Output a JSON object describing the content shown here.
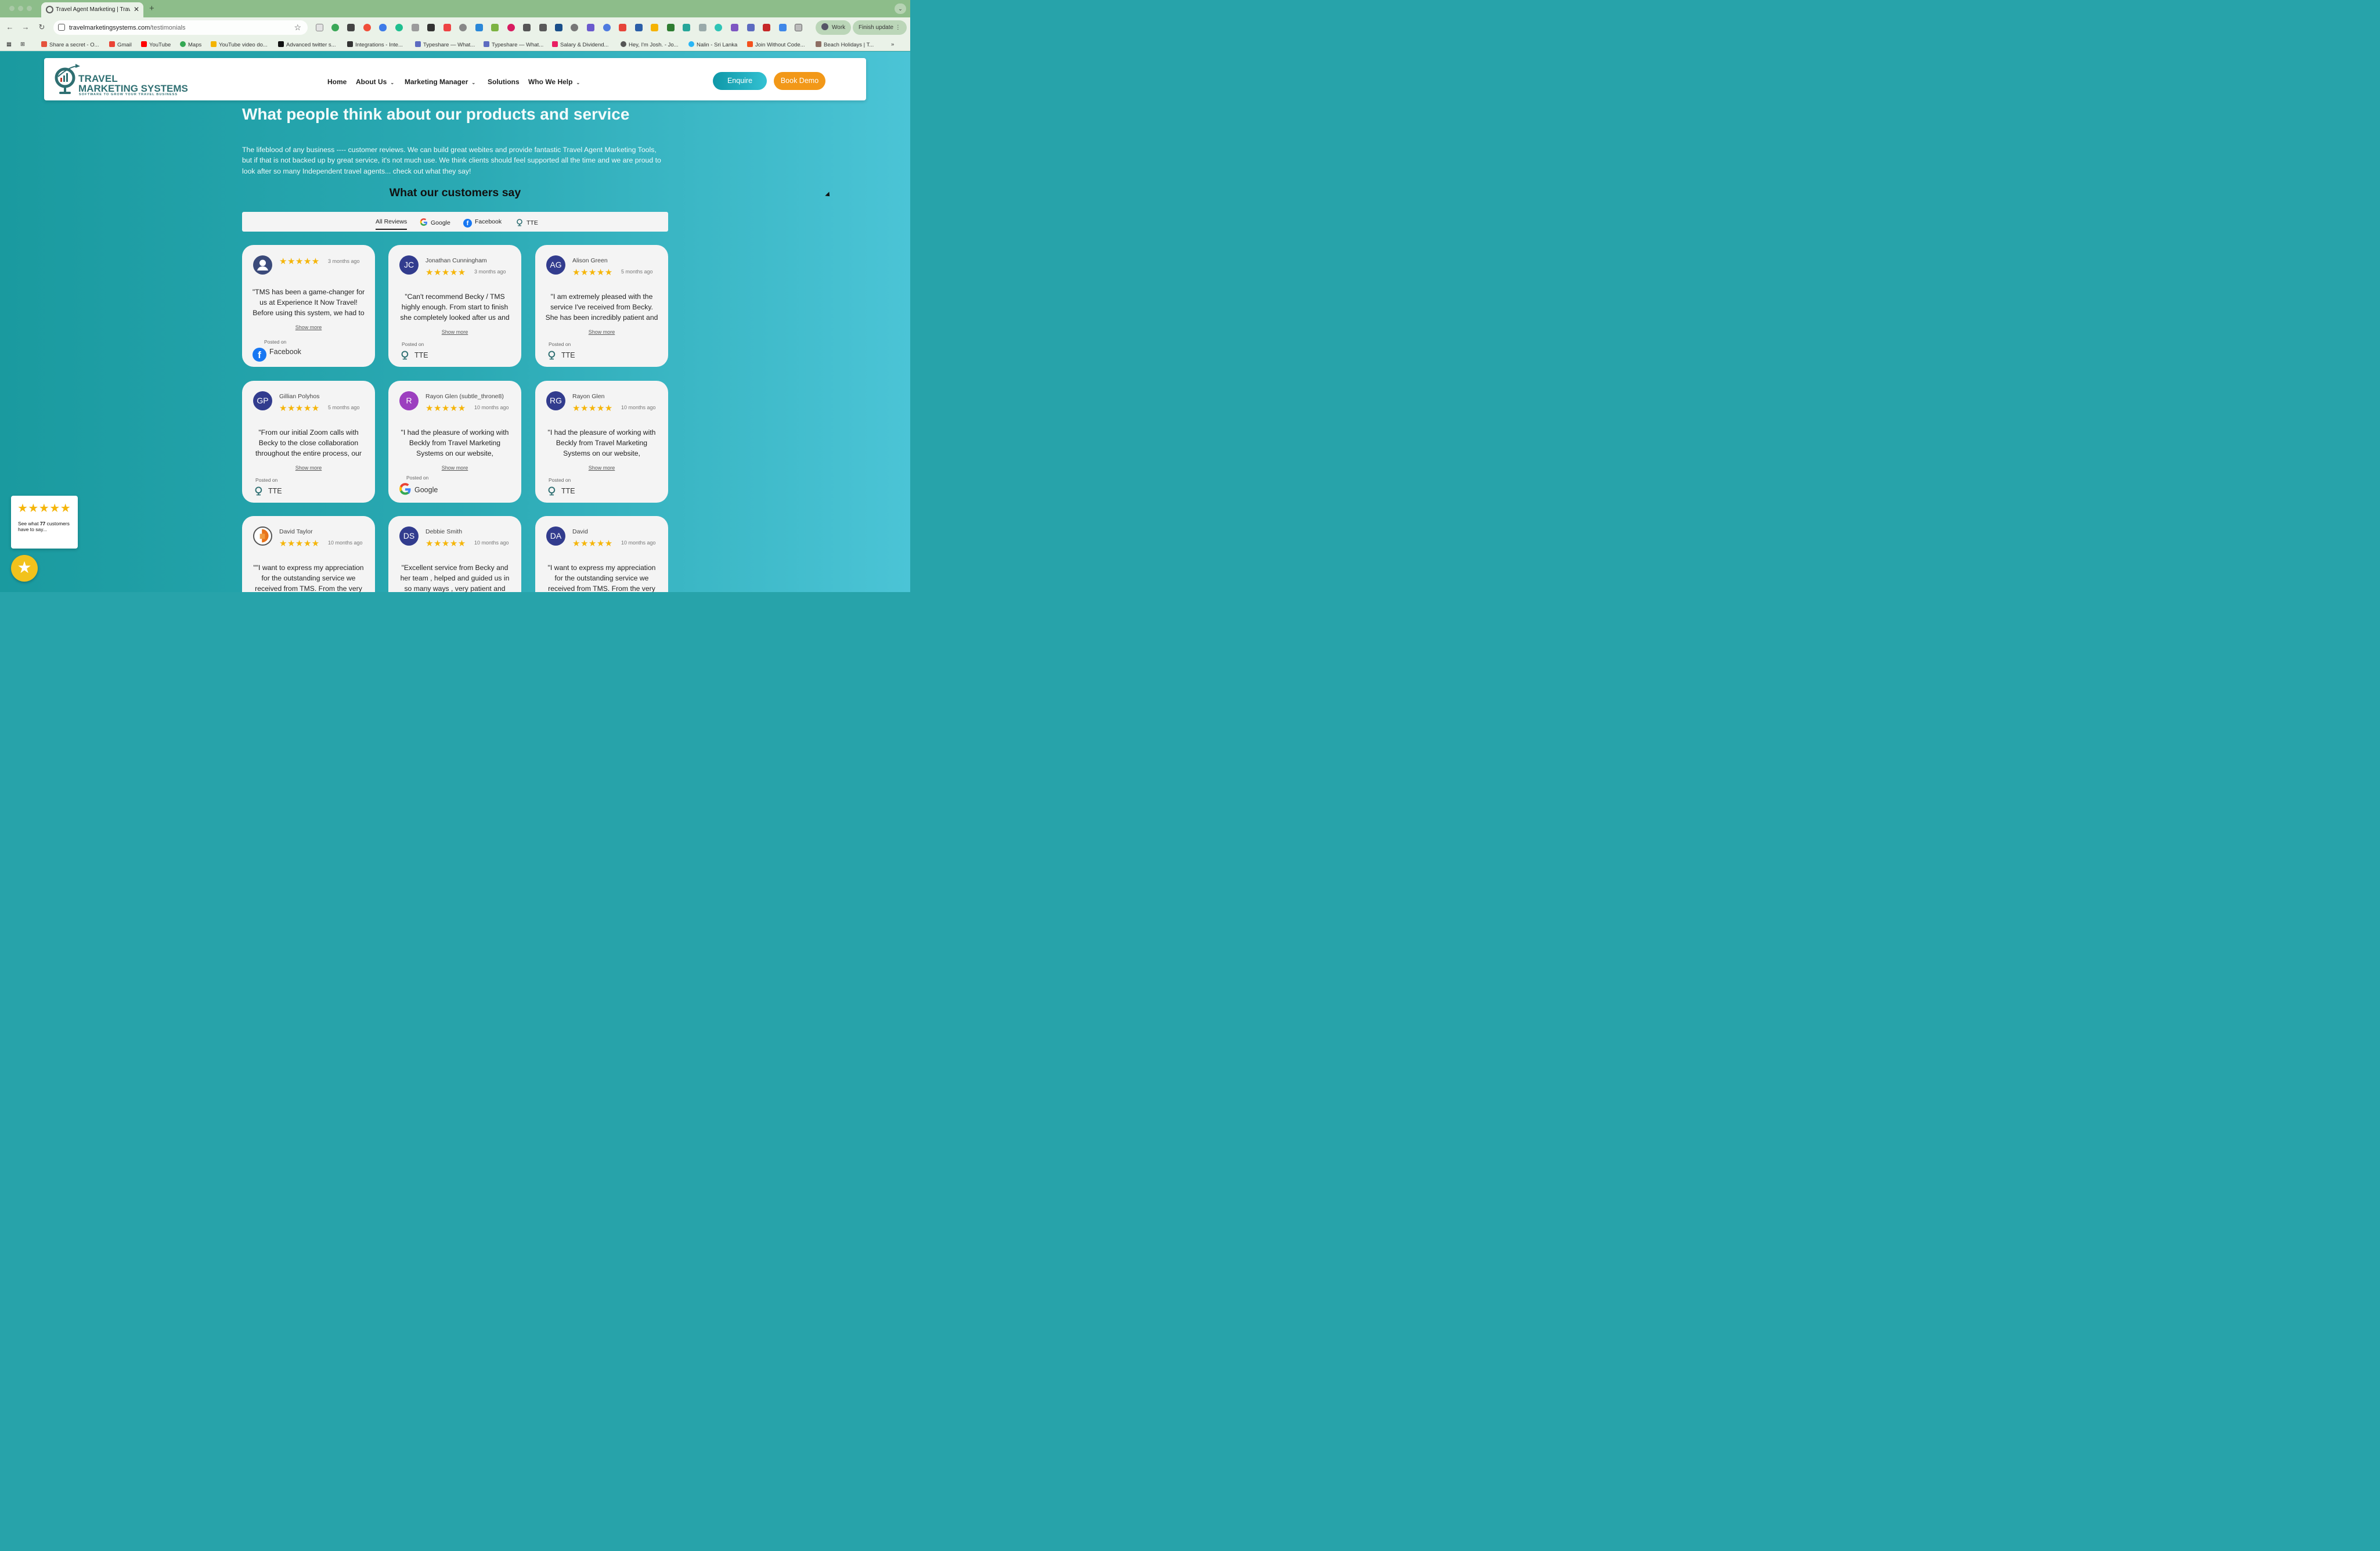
{
  "browser": {
    "tab_title": "Travel Agent Marketing | Trav",
    "url_domain": "travelmarketingsystems.com",
    "url_path": "/testimonials",
    "profile_label": "Work",
    "update_label": "Finish update",
    "ext_badges": [
      "75",
      "9",
      "31"
    ],
    "bookmarks": [
      "Share a secret - O...",
      "Gmail",
      "YouTube",
      "Maps",
      "YouTube video do...",
      "Advanced twitter s...",
      "Integrations - Inte...",
      "Typeshare — What...",
      "Typeshare — What...",
      "Salary & Dividend...",
      "Hey, I'm Josh. - Jo...",
      "Nalin - Sri Lanka",
      "Join Without Code...",
      "Beach Holidays | T..."
    ]
  },
  "site": {
    "logo_line1": "TRAVEL",
    "logo_line2": "MARKETING SYSTEMS",
    "logo_tagline": "SOFTWARE TO GROW YOUR TRAVEL BUSINESS",
    "nav": [
      "Home",
      "About Us",
      "Marketing Manager",
      "Solutions",
      "Who We Help"
    ],
    "enquire_label": "Enquire",
    "demo_label": "Book Demo"
  },
  "main": {
    "title": "What people think about our products and service",
    "intro": "The lifeblood of any business ---- customer reviews. We can build great webites and provide fantastic Travel Agent Marketing Tools, but if that is not backed up by great service, it's not much use. We think clients should feel supported all the time and we are proud to look after so many Independent travel agents... check out what they say!",
    "section_title": "What our customers say",
    "filters": [
      "All Reviews",
      "Google",
      "Facebook",
      "TTE"
    ]
  },
  "reviews": [
    {
      "name": "",
      "when": "3 months ago",
      "rating": 5,
      "text": "\"TMS has been a game-changer for us at Experience It Now Travel! Before using this system, we had to",
      "platform": "Facebook"
    },
    {
      "name": "Jonathan Cunningham",
      "initials": "JC",
      "when": "3 months ago",
      "rating": 5,
      "text": "\"Can't recommend Becky / TMS highly enough. From start to finish she completely looked after us and",
      "platform": "TTE"
    },
    {
      "name": "Alison Green",
      "initials": "AG",
      "when": "5 months ago",
      "rating": 5,
      "text": "\"I am extremely pleased with the service I've received from Becky. She has been incredibly patient and",
      "platform": "TTE"
    },
    {
      "name": "Gillian Polyhos",
      "initials": "GP",
      "when": "5 months ago",
      "rating": 5,
      "text": "\"From our initial Zoom calls with Becky to the close collaboration throughout the entire process, our",
      "platform": "TTE"
    },
    {
      "name": "Rayon Glen (subtle_throne8)",
      "initials": "R",
      "when": "10 months ago",
      "rating": 5,
      "text": "\"I had the pleasure of working with Beckly from Travel Marketing Systems on our website,",
      "platform": "Google"
    },
    {
      "name": "Rayon Glen",
      "initials": "RG",
      "when": "10 months ago",
      "rating": 5,
      "text": "\"I had the pleasure of working with Beckly from Travel Marketing Systems on our website,",
      "platform": "TTE"
    },
    {
      "name": "David Taylor",
      "initials": "",
      "when": "10 months ago",
      "rating": 5,
      "text": "\"\"I want to express my appreciation for the outstanding service we received from TMS. From the very",
      "platform": ""
    },
    {
      "name": "Debbie Smith",
      "initials": "DS",
      "when": "10 months ago",
      "rating": 5,
      "text": "\"Excellent service from Becky and her team , helped and guided us in so many ways , very patient and",
      "platform": ""
    },
    {
      "name": "David",
      "initials": "DA",
      "when": "10 months ago",
      "rating": 5,
      "text": "\"I want to express my appreciation for the outstanding service we received from TMS. From the very",
      "platform": ""
    }
  ],
  "labels": {
    "show_more": "Show more",
    "posted_on": "Posted on",
    "stars": "★★★★★"
  },
  "widget": {
    "line1": "See what ",
    "count": "77",
    "line2": " customers have to say..."
  },
  "colors": {
    "brand_teal": "#2f6f72",
    "enquire": "#0f98a8",
    "demo": "#f29818",
    "star": "#f5b50a",
    "avatar_blue": "#323c8e",
    "avatar_purple": "#9c3fbf"
  }
}
